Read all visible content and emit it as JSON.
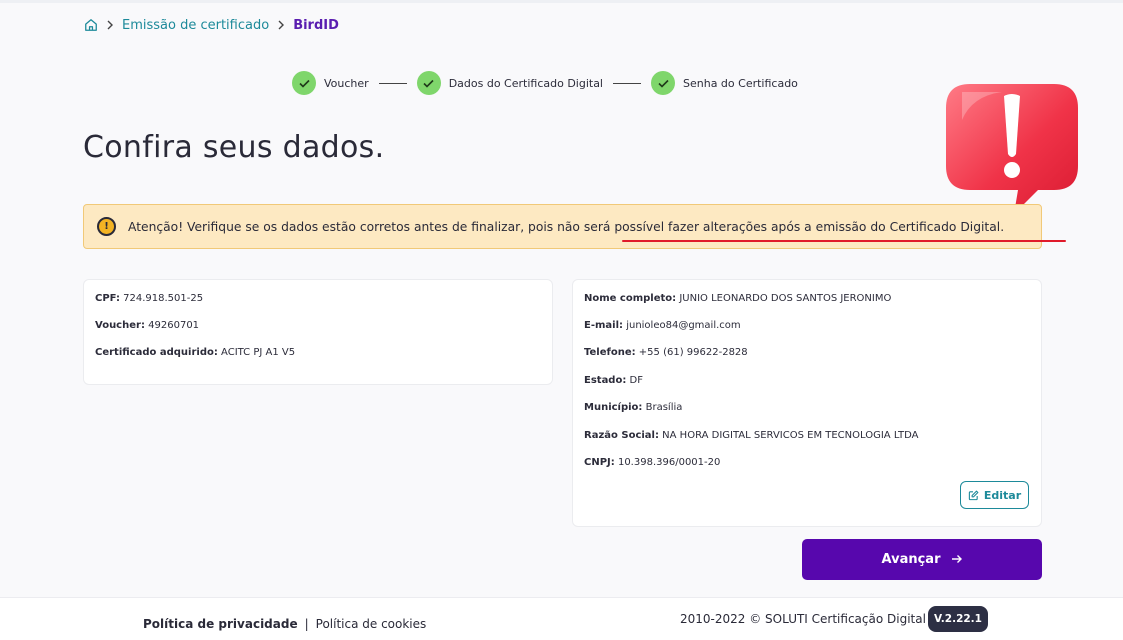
{
  "breadcrumb": {
    "home_icon": "home-icon",
    "items": [
      "Emissão de certificado",
      "BirdID"
    ]
  },
  "stepper": {
    "steps": [
      "Voucher",
      "Dados do Certificado Digital",
      "Senha do Certificado"
    ],
    "status": "completed"
  },
  "page": {
    "title": "Confira seus dados."
  },
  "alert": {
    "text_before": "Atenção! Verifique se os dados estão corretos antes de finalizar, pois ",
    "text_emphasis": "não será possível fazer alterações após a emissão do Certificado Digital."
  },
  "card_left": {
    "rows": [
      {
        "label": "CPF:",
        "value": "724.918.501-25"
      },
      {
        "label": "Voucher:",
        "value": "49260701"
      },
      {
        "label": "Certificado adquirido:",
        "value": "ACITC PJ A1 V5"
      }
    ]
  },
  "card_right": {
    "rows": [
      {
        "label": "Nome completo:",
        "value": "JUNIO LEONARDO DOS SANTOS JERONIMO"
      },
      {
        "label": "E-mail:",
        "value": "junioleo84@gmail.com"
      },
      {
        "label": "Telefone:",
        "value": "+55 (61) 99622-2828"
      },
      {
        "label": "Estado:",
        "value": "DF"
      },
      {
        "label": "Município:",
        "value": "Brasília"
      },
      {
        "label": "Razão Social:",
        "value": "NA HORA DIGITAL SERVICOS EM TECNOLOGIA LTDA"
      },
      {
        "label": "CNPJ:",
        "value": "10.398.396/0001-20"
      }
    ],
    "edit_label": "Editar"
  },
  "actions": {
    "next_label": "Avançar"
  },
  "footer": {
    "privacy_label": "Política de privacidade",
    "separator": "|",
    "cookies_label": "Política de cookies",
    "copyright": "2010-2022 © SOLUTI Certificação Digital",
    "version": "V.2.22.1"
  },
  "colors": {
    "accent_purple": "#5707ad",
    "link_teal": "#1d8a9a",
    "step_green": "#7fd66b",
    "alert_bg": "#fde9c2",
    "emphasis_red": "#e01a2a"
  }
}
